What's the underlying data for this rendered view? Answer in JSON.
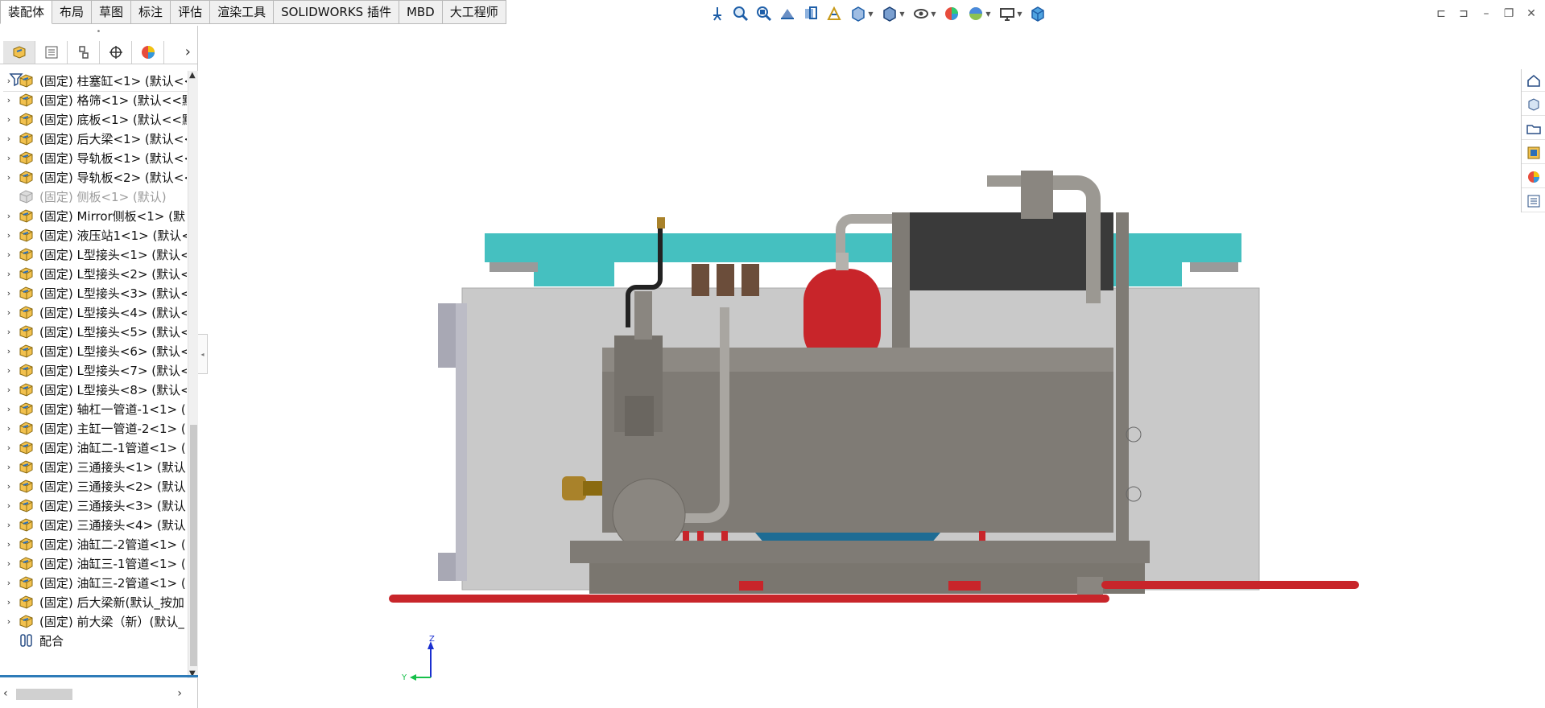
{
  "command_tabs": [
    {
      "label": "装配体",
      "active": true
    },
    {
      "label": "布局"
    },
    {
      "label": "草图"
    },
    {
      "label": "标注"
    },
    {
      "label": "评估"
    },
    {
      "label": "渲染工具"
    },
    {
      "label": "SOLIDWORKS 插件"
    },
    {
      "label": "MBD"
    },
    {
      "label": "大工程师"
    }
  ],
  "heads_up_toolbar": [
    "pin-view-icon",
    "zoom-to-fit-icon",
    "zoom-to-area-icon",
    "previous-view-icon",
    "section-view-icon",
    "dynamic-annotation-icon",
    "view-orientation-icon",
    "display-style-icon",
    "hide-show-items-icon",
    "edit-appearance-icon",
    "apply-scene-icon",
    "view-settings-icon",
    "3d-view-cube-icon"
  ],
  "feature_tree": {
    "items": [
      {
        "label": "(固定) 柱塞缸<1> (默认<<",
        "state": "normal"
      },
      {
        "label": "(固定) 格筛<1> (默认<<默",
        "state": "normal"
      },
      {
        "label": "(固定) 底板<1> (默认<<默",
        "state": "normal"
      },
      {
        "label": "(固定) 后大梁<1> (默认<<",
        "state": "normal"
      },
      {
        "label": "(固定) 导轨板<1> (默认<<",
        "state": "normal"
      },
      {
        "label": "(固定) 导轨板<2> (默认<<",
        "state": "normal"
      },
      {
        "label": "(固定) 侧板<1> (默认)",
        "state": "suppressed"
      },
      {
        "label": "(固定) Mirror侧板<1> (默",
        "state": "normal"
      },
      {
        "label": "(固定) 液压站1<1> (默认<",
        "state": "normal"
      },
      {
        "label": "(固定) L型接头<1> (默认<",
        "state": "normal"
      },
      {
        "label": "(固定) L型接头<2> (默认<",
        "state": "normal"
      },
      {
        "label": "(固定) L型接头<3> (默认<",
        "state": "normal"
      },
      {
        "label": "(固定) L型接头<4> (默认<",
        "state": "normal"
      },
      {
        "label": "(固定) L型接头<5> (默认<",
        "state": "normal"
      },
      {
        "label": "(固定) L型接头<6> (默认<",
        "state": "normal"
      },
      {
        "label": "(固定) L型接头<7> (默认<",
        "state": "normal"
      },
      {
        "label": "(固定) L型接头<8> (默认<",
        "state": "normal"
      },
      {
        "label": "(固定) 轴杠一管道-1<1> (",
        "state": "normal"
      },
      {
        "label": "(固定) 主缸一管道-2<1> (",
        "state": "normal"
      },
      {
        "label": "(固定) 油缸二-1管道<1> (",
        "state": "normal"
      },
      {
        "label": "(固定) 三通接头<1> (默认",
        "state": "normal"
      },
      {
        "label": "(固定) 三通接头<2> (默认",
        "state": "normal"
      },
      {
        "label": "(固定) 三通接头<3> (默认",
        "state": "normal"
      },
      {
        "label": "(固定) 三通接头<4> (默认",
        "state": "normal"
      },
      {
        "label": "(固定) 油缸二-2管道<1> (",
        "state": "normal"
      },
      {
        "label": "(固定) 油缸三-1管道<1> (",
        "state": "normal"
      },
      {
        "label": "(固定) 油缸三-2管道<1> (",
        "state": "normal"
      },
      {
        "label": "(固定) 后大梁新(默认_按加",
        "state": "normal"
      },
      {
        "label": "(固定) 前大梁（新）(默认_",
        "state": "normal"
      },
      {
        "label": "配合",
        "state": "mates"
      }
    ]
  },
  "triad": {
    "z_label": "Z",
    "y_label": "Y"
  },
  "colors": {
    "steel": "#7f7b75",
    "light_gray": "#c9c9c9",
    "teal": "#45c0c0",
    "red": "#c8252a",
    "dark": "#3a3a3a",
    "blue": "#1e6c94",
    "brass": "#a9822a",
    "brown": "#6b4d3a"
  }
}
